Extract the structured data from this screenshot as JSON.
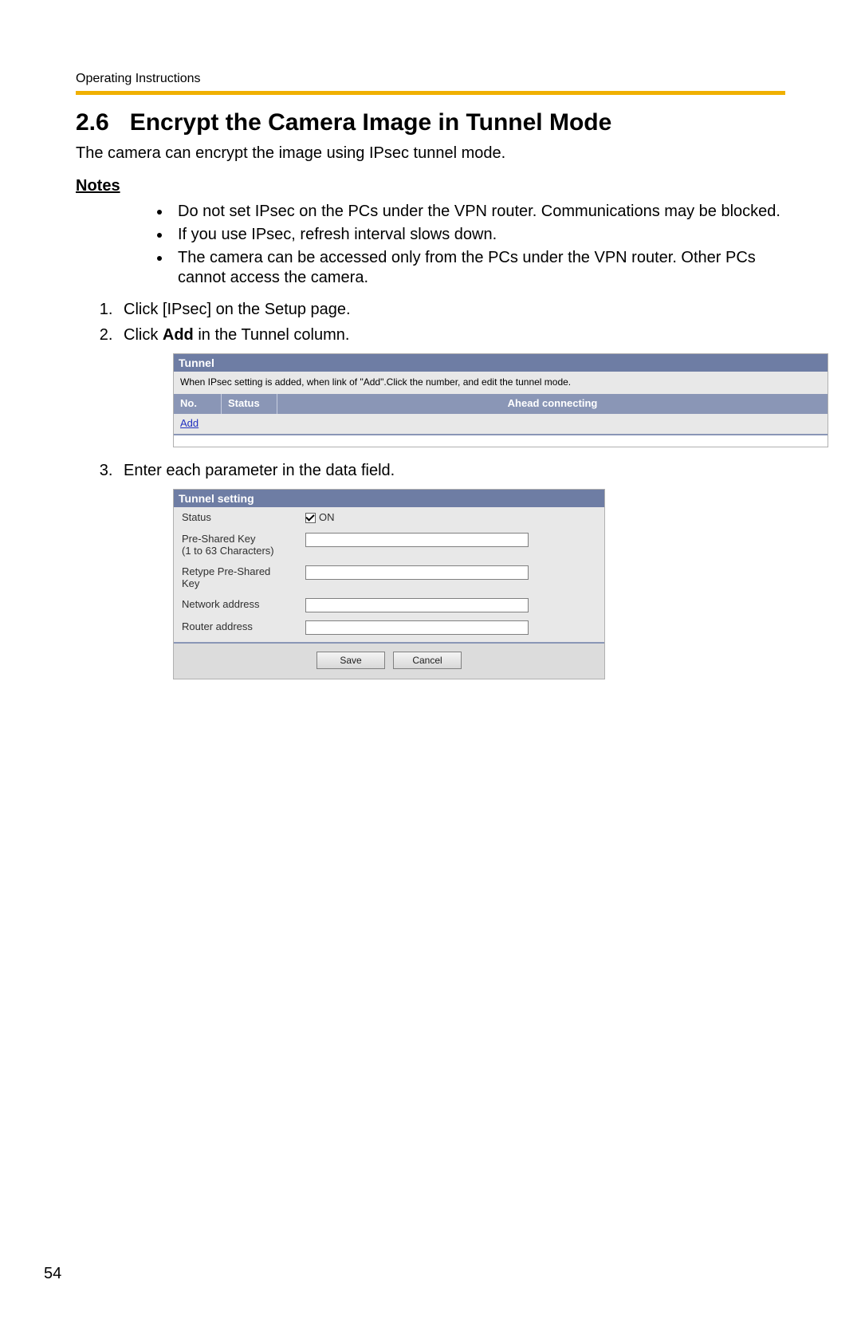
{
  "header": {
    "running": "Operating Instructions"
  },
  "section": {
    "number": "2.6",
    "title": "Encrypt the Camera Image in Tunnel Mode",
    "intro": "The camera can encrypt the image using IPsec tunnel mode."
  },
  "notes": {
    "heading": "Notes",
    "items": [
      "Do not set IPsec on the PCs under the VPN router. Communications may be blocked.",
      "If you use IPsec, refresh interval slows down.",
      "The camera can be accessed only from the PCs under the VPN router. Other PCs cannot access the camera."
    ]
  },
  "steps": {
    "s1": "Click [IPsec] on the Setup page.",
    "s2_pre": "Click ",
    "s2_bold": "Add",
    "s2_post": " in the Tunnel column.",
    "s3": "Enter each parameter in the data field."
  },
  "tunnel_table": {
    "title": "Tunnel",
    "description": "When IPsec setting is added, when link of \"Add\".Click the number, and edit the tunnel mode.",
    "columns": {
      "no": "No.",
      "status": "Status",
      "ahead": "Ahead connecting"
    },
    "add_link": "Add"
  },
  "tunnel_setting": {
    "title": "Tunnel setting",
    "rows": {
      "status_label": "Status",
      "status_value": "ON",
      "psk_label_l1": "Pre-Shared Key",
      "psk_label_l2": "(1 to 63 Characters)",
      "retype_label_l1": "Retype Pre-Shared",
      "retype_label_l2": "Key",
      "network_label": "Network address",
      "router_label": "Router address"
    },
    "buttons": {
      "save": "Save",
      "cancel": "Cancel"
    }
  },
  "page_number": "54"
}
